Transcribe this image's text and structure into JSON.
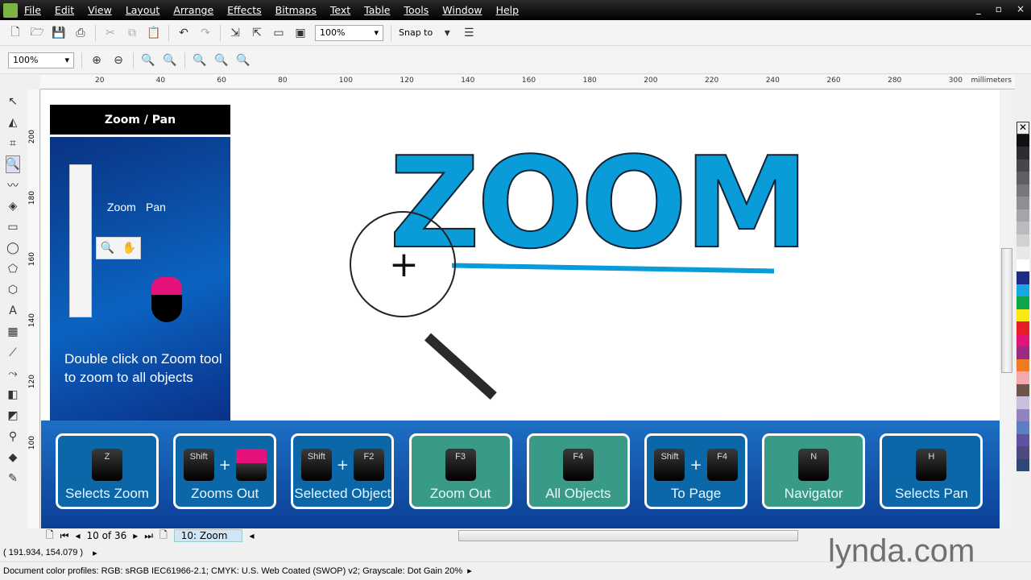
{
  "menu": [
    "File",
    "Edit",
    "View",
    "Layout",
    "Arrange",
    "Effects",
    "Bitmaps",
    "Text",
    "Table",
    "Tools",
    "Window",
    "Help"
  ],
  "window_controls": [
    "_",
    "▫",
    "×"
  ],
  "toolbar": {
    "zoom_level": "100%",
    "snap_label": "Snap to"
  },
  "zoombar": {
    "zoom_level": "100%"
  },
  "ruler": {
    "top": [
      "20",
      "40",
      "60",
      "80",
      "100",
      "120",
      "140",
      "160",
      "180",
      "200",
      "220",
      "240",
      "260",
      "280",
      "300"
    ],
    "units": "millimeters",
    "left": [
      "200",
      "180",
      "160",
      "140",
      "120",
      "100"
    ]
  },
  "slide": {
    "title": "Zoom / Pan",
    "zoom_label": "Zoom",
    "pan_label": "Pan",
    "tip": "Double click on Zoom tool to zoom to all objects",
    "headline": "ZOOM"
  },
  "cards": [
    {
      "keys": [
        "Z"
      ],
      "label": "Selects Zoom",
      "color": "#0b67a8"
    },
    {
      "keys": [
        "Shift",
        "mouse"
      ],
      "label": "Zooms Out",
      "color": "#0b67a8"
    },
    {
      "keys": [
        "Shift",
        "F2"
      ],
      "label": "Selected Object",
      "color": "#0b67a8"
    },
    {
      "keys": [
        "F3"
      ],
      "label": "Zoom Out",
      "color": "#3a9a88"
    },
    {
      "keys": [
        "F4"
      ],
      "label": "All Objects",
      "color": "#3a9a88"
    },
    {
      "keys": [
        "Shift",
        "F4"
      ],
      "label": "To Page",
      "color": "#0b67a8"
    },
    {
      "keys": [
        "N"
      ],
      "label": "Navigator",
      "color": "#3a9a88"
    },
    {
      "keys": [
        "H"
      ],
      "label": "Selects Pan",
      "color": "#0b67a8"
    }
  ],
  "pager": {
    "position": "10 of 36",
    "tab": "10: Zoom"
  },
  "status": {
    "coords": "( 191.934, 154.079 )",
    "profiles": "Document color profiles: RGB: sRGB IEC61966-2.1; CMYK: U.S. Web Coated (SWOP) v2; Grayscale: Dot Gain 20%"
  },
  "watermark": "lynda.com",
  "palette": [
    "#111111",
    "#2b2d31",
    "#45474a",
    "#5f6063",
    "#77787b",
    "#8e8f92",
    "#a4a5a8",
    "#babbbd",
    "#d0d1d2",
    "#e6e7e8",
    "#ffffff",
    "#1d2b8c",
    "#1aa6e0",
    "#0fa54b",
    "#fbe711",
    "#e61f26",
    "#e5127c",
    "#9a2a83",
    "#ef7a22",
    "#f5a7b0",
    "#6d554a",
    "#c8c0dd",
    "#8d84c0",
    "#5a7fc5",
    "#5f52a0",
    "#4e4a80",
    "#2e4877"
  ],
  "accent": "#0a9bd9"
}
